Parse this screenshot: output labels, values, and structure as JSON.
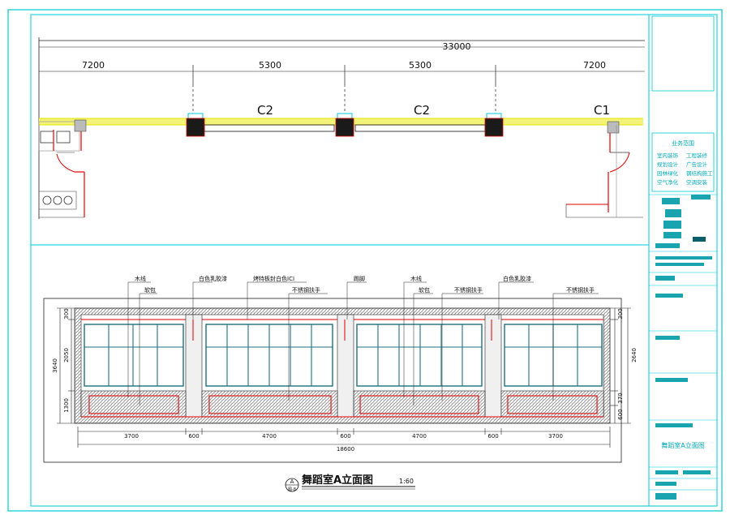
{
  "plan": {
    "total_dim": "33000",
    "segments": [
      "7200",
      "5300",
      "5300",
      "7200"
    ],
    "window_labels": [
      "C2",
      "C2",
      "C1"
    ]
  },
  "elevation": {
    "callouts": [
      "木线",
      "软包",
      "白色乳胶漆",
      "烤特板封白色ICI",
      "踢脚",
      "木线",
      "软包",
      "不锈钢扶手",
      "白色乳胶漆",
      "不锈钢扶手",
      "不锈钢扶手"
    ],
    "left_dims": [
      "300",
      "2050",
      "1300"
    ],
    "left_total": "3640",
    "right_dims": [
      "300",
      "370",
      "600"
    ],
    "right_total": "2640",
    "bottom_dims": [
      "3700",
      "600",
      "4700",
      "600",
      "4700",
      "600",
      "3700"
    ],
    "bottom_total": "18600"
  },
  "title": {
    "marker": "A",
    "sheet": "图-8",
    "name": "舞蹈室A立面图",
    "scale": "1:60"
  },
  "title_block": {
    "section_heading": "业务范围",
    "services": [
      "室内装饰",
      "工程装修",
      "规划设计",
      "广告设计",
      "园林绿化",
      "钢结构施工",
      "空气净化",
      "空调安装"
    ],
    "drawing_name": "舞蹈室A立面图"
  },
  "colors": {
    "frame": "#00c8d8",
    "wall": "#e6e600",
    "column": "#1a1a1a",
    "red": "#e00000",
    "dim": "#222222",
    "window": "#1f6f7f",
    "hatch": "#555555"
  }
}
